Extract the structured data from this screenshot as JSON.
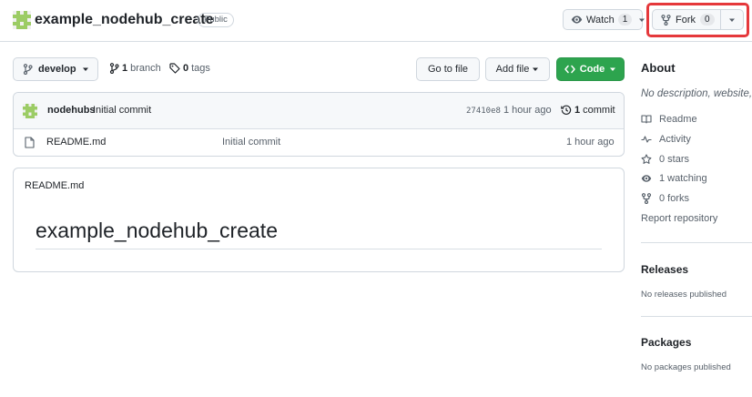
{
  "repo": {
    "name": "example_nodehub_create",
    "visibility": "Public"
  },
  "actions": {
    "watch_label": "Watch",
    "watch_count": "1",
    "fork_label": "Fork",
    "fork_count": "0"
  },
  "branch_bar": {
    "current_branch": "develop",
    "branch_count": "1",
    "branch_label": "branch",
    "tag_count": "0",
    "tag_label": "tags",
    "goto_file_label": "Go to file",
    "add_file_label": "Add file",
    "code_label": "Code"
  },
  "latest_commit": {
    "author": "nodehubs",
    "message": "Initial commit",
    "hash": "27410e8",
    "time": "1 hour ago",
    "commit_count": "1",
    "commit_label": "commit"
  },
  "files": [
    {
      "name": "README.md",
      "commit_message": "Initial commit",
      "time": "1 hour ago"
    }
  ],
  "readme": {
    "label": "README.md",
    "heading": "example_nodehub_create"
  },
  "about": {
    "title": "About",
    "description": "No description, website,",
    "items": [
      {
        "icon": "book-icon",
        "label": "Readme"
      },
      {
        "icon": "pulse-icon",
        "label": "Activity"
      },
      {
        "icon": "star-icon",
        "label": "0 stars"
      },
      {
        "icon": "eye-icon",
        "label": "1 watching"
      },
      {
        "icon": "fork-icon",
        "label": "0 forks"
      }
    ],
    "report_label": "Report repository"
  },
  "releases": {
    "title": "Releases",
    "empty_text": "No releases published"
  },
  "packages": {
    "title": "Packages",
    "empty_text": "No packages published"
  },
  "colors": {
    "highlight": "#e5383b",
    "code_button": "#2da44e",
    "avatar_green": "#8bc34a"
  }
}
